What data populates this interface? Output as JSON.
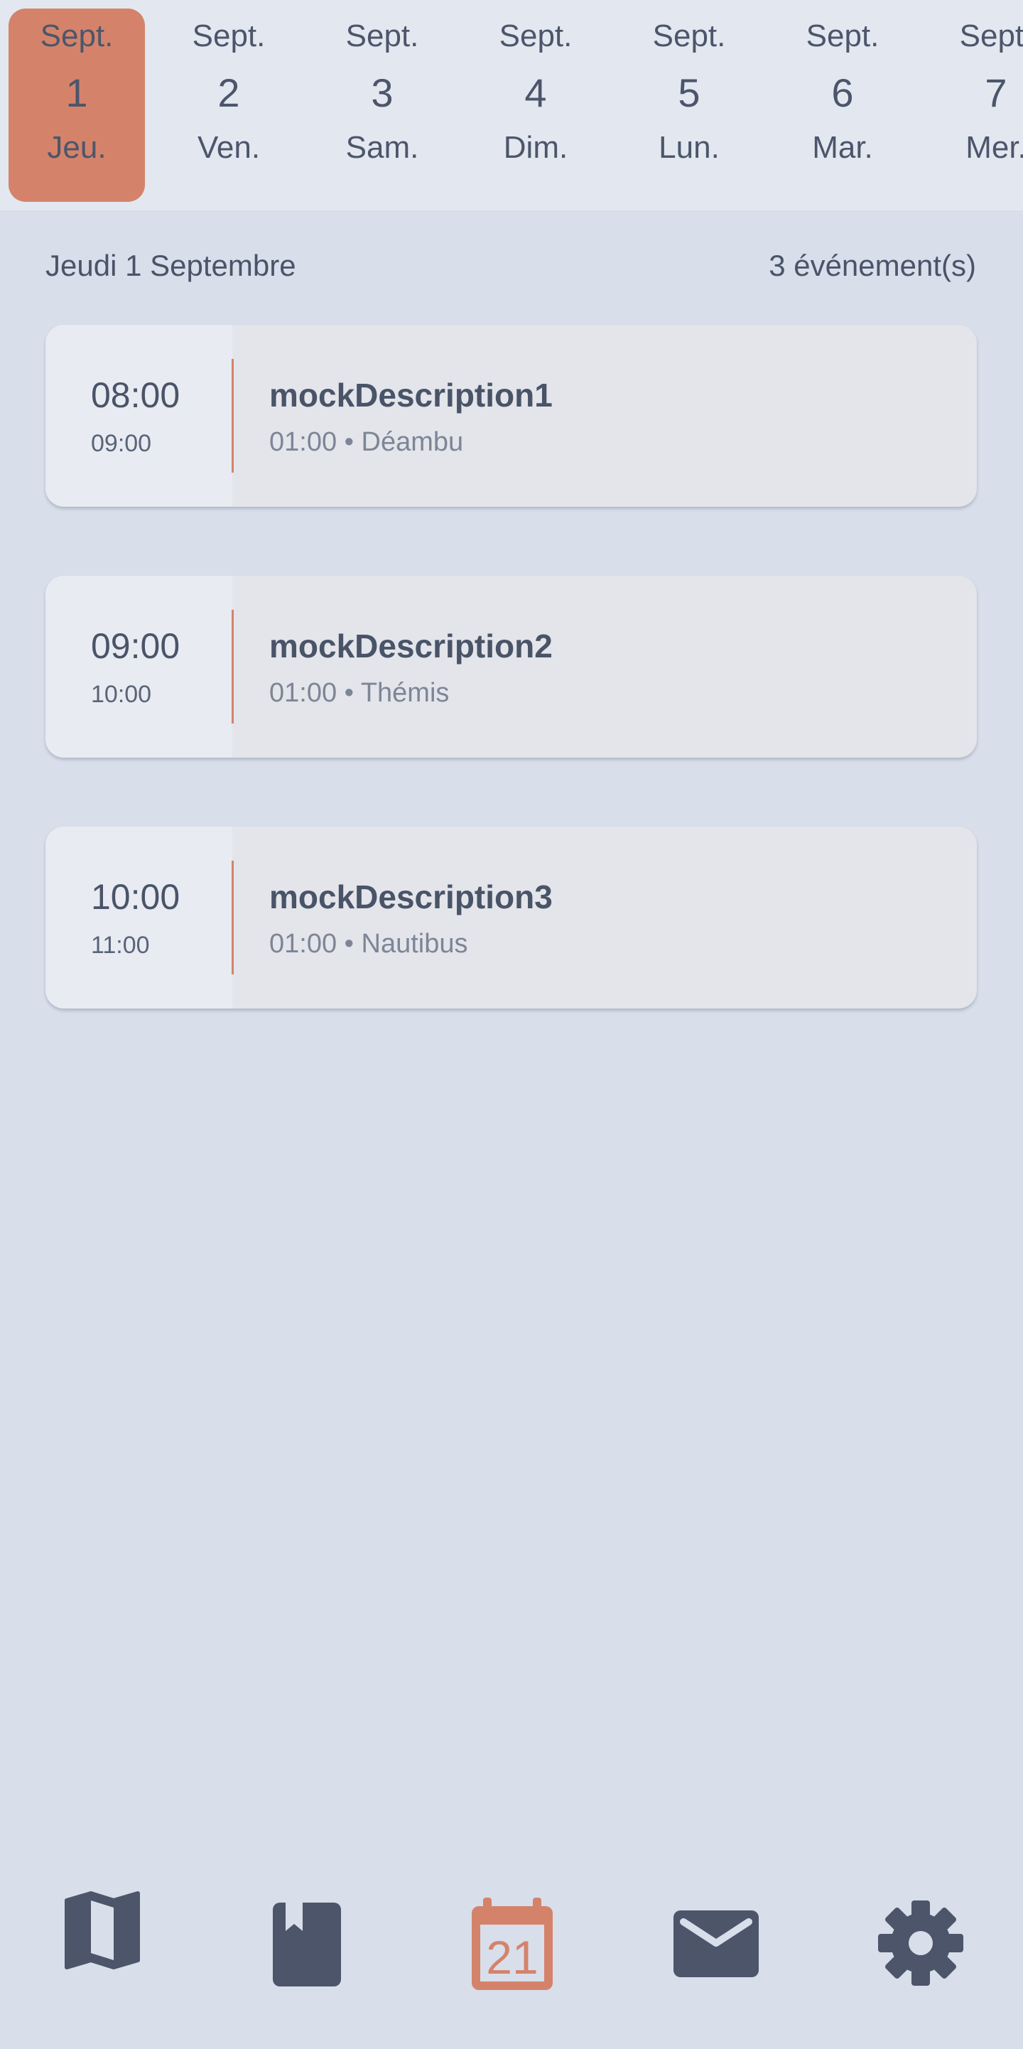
{
  "date_strip": {
    "days": [
      {
        "month": "Sept.",
        "day": "1",
        "weekday": "Jeu.",
        "selected": true
      },
      {
        "month": "Sept.",
        "day": "2",
        "weekday": "Ven."
      },
      {
        "month": "Sept.",
        "day": "3",
        "weekday": "Sam."
      },
      {
        "month": "Sept.",
        "day": "4",
        "weekday": "Dim."
      },
      {
        "month": "Sept.",
        "day": "5",
        "weekday": "Lun."
      },
      {
        "month": "Sept.",
        "day": "6",
        "weekday": "Mar."
      },
      {
        "month": "Sept.",
        "day": "7",
        "weekday": "Mer."
      }
    ]
  },
  "header": {
    "date_label": "Jeudi 1 Septembre",
    "event_count": "3 événement(s)"
  },
  "events": [
    {
      "start": "08:00",
      "end": "09:00",
      "title": "mockDescription1",
      "meta": "01:00 • Déambu"
    },
    {
      "start": "09:00",
      "end": "10:00",
      "title": "mockDescription2",
      "meta": "01:00 • Thémis"
    },
    {
      "start": "10:00",
      "end": "11:00",
      "title": "mockDescription3",
      "meta": "01:00 • Nautibus"
    }
  ],
  "bottom_nav": {
    "items": [
      {
        "icon": "map-icon"
      },
      {
        "icon": "book-icon"
      },
      {
        "icon": "calendar-icon",
        "label": "21",
        "active": true
      },
      {
        "icon": "mail-icon"
      },
      {
        "icon": "settings-icon"
      }
    ]
  },
  "colors": {
    "accent": "#d4836a",
    "background": "#d8deea",
    "text": "#4a5468"
  }
}
